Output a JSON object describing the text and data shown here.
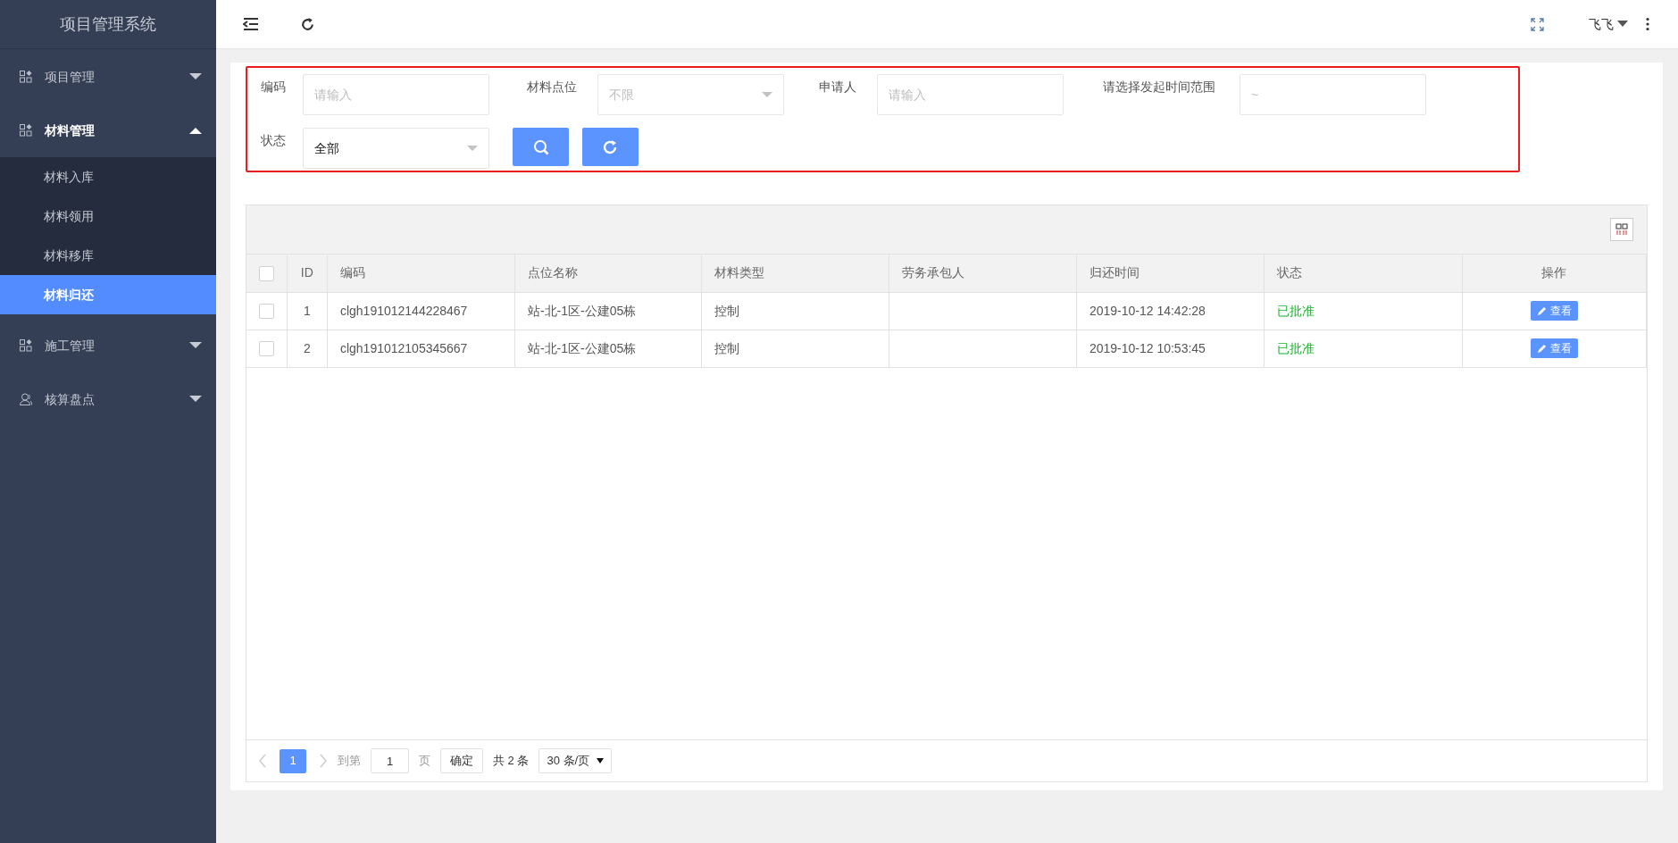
{
  "sidebar": {
    "title": "项目管理系统",
    "items": [
      {
        "label": "项目管理",
        "expanded": false
      },
      {
        "label": "材料管理",
        "expanded": true,
        "children": [
          {
            "label": "材料入库",
            "selected": false
          },
          {
            "label": "材料领用",
            "selected": false
          },
          {
            "label": "材料移库",
            "selected": false
          },
          {
            "label": "材料归还",
            "selected": true
          }
        ]
      },
      {
        "label": "施工管理",
        "expanded": false
      },
      {
        "label": "核算盘点",
        "expanded": false
      }
    ]
  },
  "topbar": {
    "user": "飞飞"
  },
  "filters": [
    {
      "kind": "text",
      "label": "编码",
      "placeholder": "请输入"
    },
    {
      "kind": "select",
      "label": "材料点位",
      "placeholder": "不限"
    },
    {
      "kind": "text",
      "label": "申请人",
      "placeholder": "请输入"
    },
    {
      "kind": "range",
      "label": "请选择发起时间范围",
      "placeholder": "~"
    },
    {
      "kind": "select",
      "label": "状态",
      "value": "全部"
    }
  ],
  "table": {
    "header_checked": false,
    "columns": [
      {
        "label": "ID",
        "kind": "id"
      },
      {
        "label": "编码",
        "kind": "text"
      },
      {
        "label": "点位名称",
        "kind": "text"
      },
      {
        "label": "材料类型",
        "kind": "text"
      },
      {
        "label": "劳务承包人",
        "kind": "text"
      },
      {
        "label": "归还时间",
        "kind": "text"
      },
      {
        "label": "状态",
        "kind": "status"
      },
      {
        "label": "操作",
        "kind": "action"
      }
    ],
    "rows": [
      {
        "checked": false,
        "cells": [
          "1",
          "clgh191012144228467",
          "站-北-1区-公建05栋",
          "控制",
          "",
          "2019-10-12 14:42:28",
          "已批准",
          "查看"
        ]
      },
      {
        "checked": false,
        "cells": [
          "2",
          "clgh191012105345667",
          "站-北-1区-公建05栋",
          "控制",
          "",
          "2019-10-12 10:53:45",
          "已批准",
          "查看"
        ]
      }
    ]
  },
  "pagination": {
    "pages": [
      {
        "label": "1",
        "selected": true
      }
    ],
    "goto_label": "到第",
    "goto_value": "1",
    "page_unit": "页",
    "confirm": "确定",
    "total": "共 2 条",
    "page_size": "30 条/页"
  }
}
